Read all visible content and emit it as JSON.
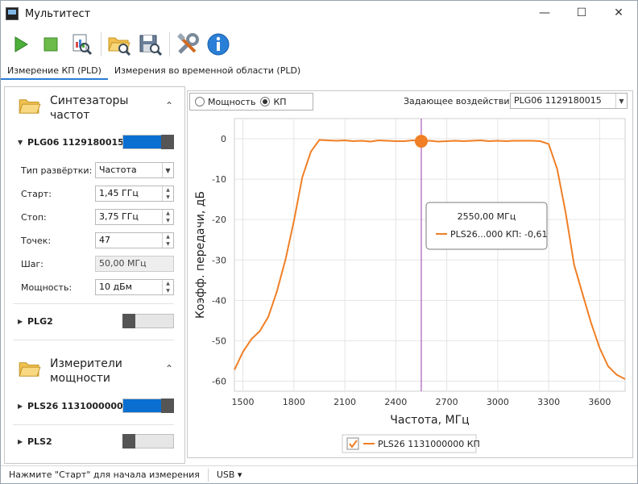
{
  "window": {
    "title": "Мультитест",
    "min_glyph": "—",
    "max_glyph": "☐",
    "close_glyph": "✕"
  },
  "toolbar": {
    "buttons": [
      {
        "icon": "play-icon"
      },
      {
        "icon": "stop-icon"
      },
      {
        "icon": "report-search-icon"
      },
      {
        "icon": "open-folder-icon"
      },
      {
        "icon": "save-icon"
      },
      {
        "icon": "tools-icon"
      },
      {
        "icon": "info-icon"
      }
    ]
  },
  "tabs": [
    {
      "label": "Измерение КП (PLD)",
      "active": true
    },
    {
      "label": "Измерения во временной области (PLD)",
      "active": false
    }
  ],
  "sidebar": {
    "synth_group": {
      "title_line1": "Синтезаторы",
      "title_line2": "частот",
      "chevron": "⌃"
    },
    "generator1": {
      "name": "PLG06 1129180015",
      "on": true,
      "fields": {
        "sweep_label": "Тип развёртки:",
        "sweep_value": "Частота",
        "start_label": "Старт:",
        "start_value": "1,45  ГГц",
        "stop_label": "Стоп:",
        "stop_value": "3,75  ГГц",
        "points_label": "Точек:",
        "points_value": "47",
        "step_label": "Шаг:",
        "step_value": "50,00 МГц",
        "power_label": "Мощность:",
        "power_value": "10  дБм"
      }
    },
    "generator2": {
      "name": "PLG2",
      "on": false
    },
    "meter_group": {
      "title_line1": "Измерители",
      "title_line2": "мощности",
      "chevron": "⌃"
    },
    "meter1": {
      "name": "PLS26 1131000000",
      "on": true
    },
    "meter2": {
      "name": "PLS2",
      "on": false
    },
    "collapse_glyph": "▶"
  },
  "mode": {
    "power_label": "Мощность",
    "kp_label": "КП",
    "selected": "КП",
    "excitation_label": "Задающее воздействие:",
    "excitation_value": "PLG06 1129180015"
  },
  "status": {
    "text": "Нажмите \"Старт\" для начала измерения",
    "usb_label": "USB ▾"
  },
  "colors": {
    "accent": "#2a7cd4",
    "series": "#f07f25",
    "cursor": "#9b37b0",
    "toggle_on": "#0a6fd1"
  },
  "chart_data": {
    "type": "line",
    "xlabel": "Частота, МГц",
    "ylabel": "Коэфф. передачи, дБ",
    "xlim": [
      1450,
      3750
    ],
    "ylim": [
      -62.5,
      5
    ],
    "xticks": [
      1500,
      1800,
      2100,
      2400,
      2700,
      3000,
      3300,
      3600
    ],
    "yticks": [
      0,
      -10,
      -20,
      -30,
      -40,
      -50,
      -60
    ],
    "grid": true,
    "legend_position": "bottom-center",
    "series": [
      {
        "name": "PLS26 1131000000 КП",
        "x": [
          1450,
          1500,
          1550,
          1600,
          1650,
          1700,
          1750,
          1800,
          1850,
          1900,
          1950,
          2000,
          2050,
          2100,
          2150,
          2200,
          2250,
          2300,
          2350,
          2400,
          2450,
          2500,
          2550,
          2600,
          2650,
          2700,
          2750,
          2800,
          2850,
          2900,
          2950,
          3000,
          3050,
          3100,
          3150,
          3200,
          3250,
          3300,
          3350,
          3400,
          3450,
          3500,
          3550,
          3600,
          3650,
          3700,
          3750
        ],
        "y": [
          -57.2,
          -52.8,
          -49.6,
          -47.6,
          -44.0,
          -37.8,
          -30.0,
          -20.4,
          -9.5,
          -3.2,
          -0.3,
          -0.4,
          -0.5,
          -0.4,
          -0.6,
          -0.5,
          -0.7,
          -0.4,
          -0.5,
          -0.6,
          -0.6,
          -0.4,
          -0.6,
          -0.5,
          -0.7,
          -0.6,
          -0.5,
          -0.6,
          -0.5,
          -0.4,
          -0.6,
          -0.5,
          -0.6,
          -0.5,
          -0.5,
          -0.5,
          -0.6,
          -1.3,
          -7.5,
          -18.3,
          -31.2,
          -38.5,
          -45.6,
          -51.8,
          -56.3,
          -58.4,
          -59.5
        ]
      }
    ],
    "cursor": {
      "x": 2550,
      "y": -0.61
    },
    "tooltip": {
      "title": "2550,00 МГц",
      "entry": "PLS26...000 КП: -0,61"
    },
    "legend": [
      {
        "label": "PLS26 1131000000 КП",
        "checked": true
      }
    ]
  }
}
